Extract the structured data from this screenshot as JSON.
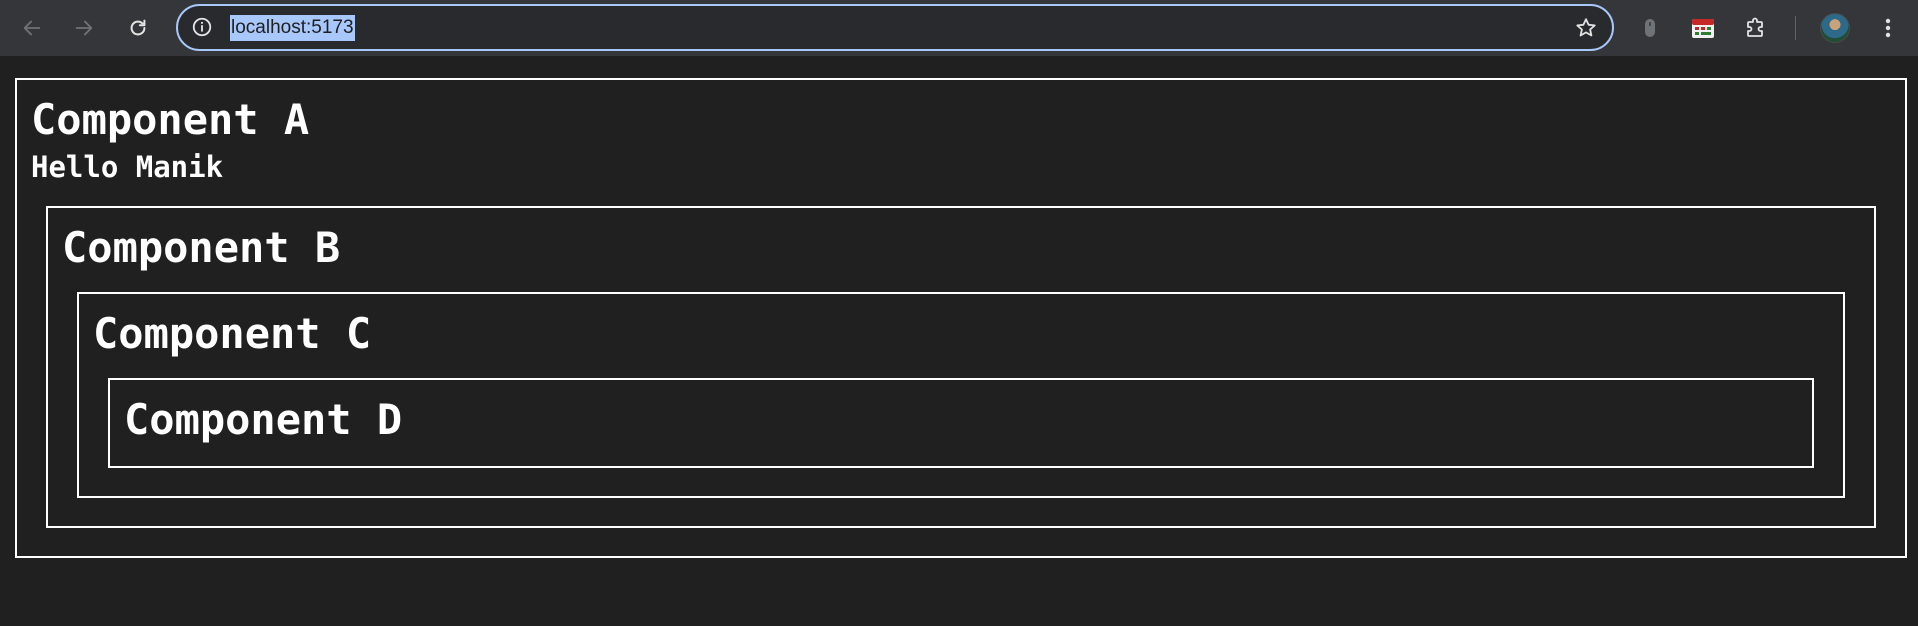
{
  "browser": {
    "url": "localhost:5173",
    "icons": {
      "back": "arrow-left-icon",
      "forward": "arrow-right-icon",
      "reload": "reload-icon",
      "site_info": "info-icon",
      "bookmark": "star-icon",
      "extension_1": "mouse-icon",
      "extension_2": "calendar-extension-icon",
      "extensions_menu": "puzzle-icon",
      "profile": "avatar",
      "menu": "kebab-menu-icon"
    },
    "colors": {
      "toolbar": "#35363a",
      "omnibox_border": "#a8c7fa",
      "url_highlight": "#a8c7fa"
    }
  },
  "page": {
    "background": "#202020",
    "border_color": "#ffffff",
    "text_color": "#ffffff",
    "components": {
      "a": {
        "title": "Component A",
        "greeting": "Hello Manik"
      },
      "b": {
        "title": "Component B"
      },
      "c": {
        "title": "Component C"
      },
      "d": {
        "title": "Component D"
      }
    }
  }
}
